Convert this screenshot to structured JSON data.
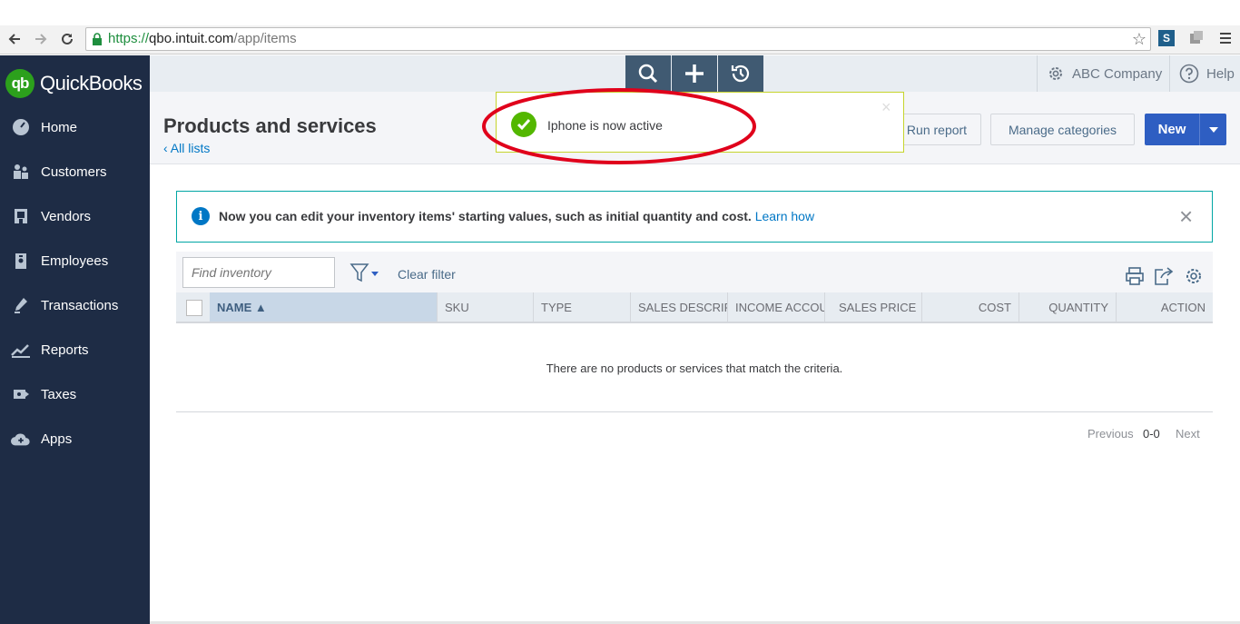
{
  "browser": {
    "url_scheme": "https://",
    "url_host": "qbo.intuit.com",
    "url_path": "/app/items",
    "ext_label": "S"
  },
  "brand": {
    "logo_mark": "qb",
    "name": "QuickBooks",
    "color": "#2ca01c"
  },
  "sidebar": {
    "items": [
      {
        "label": "Home",
        "icon": "dashboard-icon"
      },
      {
        "label": "Customers",
        "icon": "customers-icon"
      },
      {
        "label": "Vendors",
        "icon": "vendors-icon"
      },
      {
        "label": "Employees",
        "icon": "employees-icon"
      },
      {
        "label": "Transactions",
        "icon": "transactions-icon"
      },
      {
        "label": "Reports",
        "icon": "reports-icon"
      },
      {
        "label": "Taxes",
        "icon": "taxes-icon"
      },
      {
        "label": "Apps",
        "icon": "apps-icon"
      }
    ]
  },
  "topbar": {
    "company": "ABC Company",
    "help": "Help"
  },
  "page": {
    "title": "Products and services",
    "back_link": "All lists",
    "run_report": "Run report",
    "manage_categories": "Manage categories",
    "new_button": "New"
  },
  "toast": {
    "message": "Iphone is now active",
    "close": "×"
  },
  "banner": {
    "icon": "i",
    "text": "Now you can edit your inventory items' starting values, such as initial quantity and cost.",
    "link": "Learn how",
    "close": "×"
  },
  "filter": {
    "placeholder": "Find inventory",
    "clear": "Clear filter"
  },
  "table": {
    "columns": [
      "NAME ▲",
      "SKU",
      "TYPE",
      "SALES DESCRIPTION",
      "INCOME ACCOUNT",
      "SALES PRICE",
      "COST",
      "QUANTITY",
      "ACTION"
    ],
    "empty_message": "There are no products or services that match the criteria."
  },
  "pager": {
    "previous": "Previous",
    "range": "0-0",
    "next": "Next"
  },
  "colors": {
    "sidebar_bg": "#1e2c45",
    "primary_button": "#2e5ec2",
    "link": "#0077c5",
    "annotation": "#e0001b"
  }
}
